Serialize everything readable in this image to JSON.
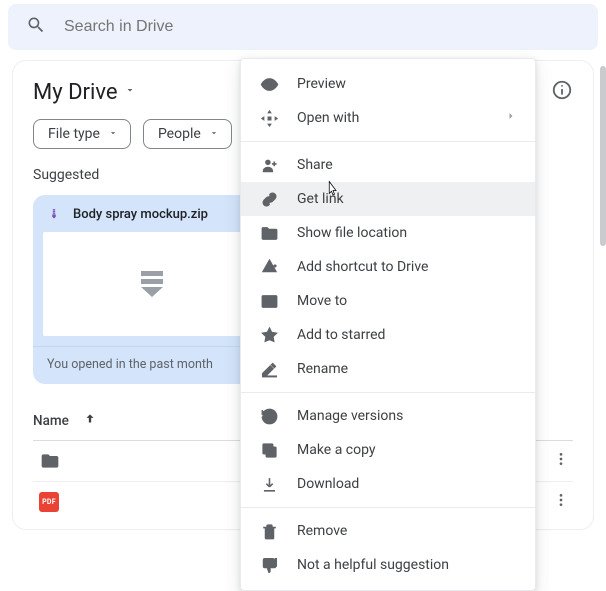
{
  "search": {
    "placeholder": "Search in Drive"
  },
  "header": {
    "title": "My Drive"
  },
  "chips": {
    "file_type": "File type",
    "people": "People"
  },
  "suggested": {
    "label": "Suggested",
    "file_name": "Body spray mockup.zip",
    "footer": "You opened in the past month"
  },
  "table": {
    "name_header": "Name"
  },
  "rows": {
    "pdf_label": "PDF"
  },
  "menu": {
    "preview": "Preview",
    "open_with": "Open with",
    "share": "Share",
    "get_link": "Get link",
    "show_location": "Show file location",
    "add_shortcut": "Add shortcut to Drive",
    "move_to": "Move to",
    "add_starred": "Add to starred",
    "rename": "Rename",
    "manage_versions": "Manage versions",
    "make_copy": "Make a copy",
    "download": "Download",
    "remove": "Remove",
    "not_helpful": "Not a helpful suggestion"
  }
}
